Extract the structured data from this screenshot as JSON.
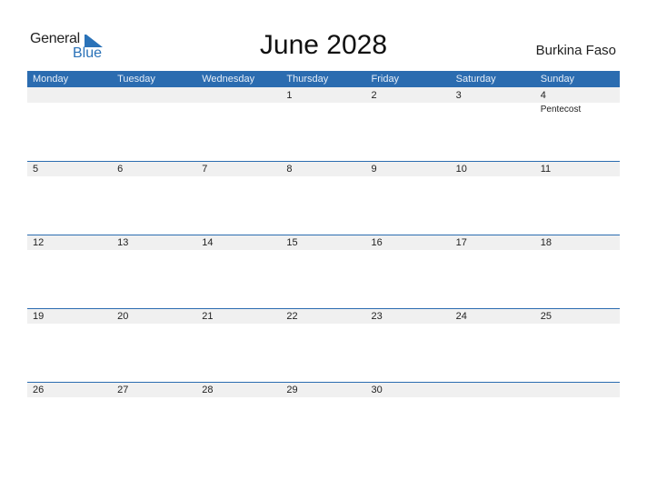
{
  "logo": {
    "general": "General",
    "blue": "Blue"
  },
  "title": "June 2028",
  "country": "Burkina Faso",
  "colors": {
    "accent": "#2b6cb0",
    "band": "#f0f0f0"
  },
  "days": [
    "Monday",
    "Tuesday",
    "Wednesday",
    "Thursday",
    "Friday",
    "Saturday",
    "Sunday"
  ],
  "weeks": [
    [
      {
        "d": ""
      },
      {
        "d": ""
      },
      {
        "d": ""
      },
      {
        "d": "1"
      },
      {
        "d": "2"
      },
      {
        "d": "3"
      },
      {
        "d": "4",
        "event": "Pentecost"
      }
    ],
    [
      {
        "d": "5"
      },
      {
        "d": "6"
      },
      {
        "d": "7"
      },
      {
        "d": "8"
      },
      {
        "d": "9"
      },
      {
        "d": "10"
      },
      {
        "d": "11"
      }
    ],
    [
      {
        "d": "12"
      },
      {
        "d": "13"
      },
      {
        "d": "14"
      },
      {
        "d": "15"
      },
      {
        "d": "16"
      },
      {
        "d": "17"
      },
      {
        "d": "18"
      }
    ],
    [
      {
        "d": "19"
      },
      {
        "d": "20"
      },
      {
        "d": "21"
      },
      {
        "d": "22"
      },
      {
        "d": "23"
      },
      {
        "d": "24"
      },
      {
        "d": "25"
      }
    ],
    [
      {
        "d": "26"
      },
      {
        "d": "27"
      },
      {
        "d": "28"
      },
      {
        "d": "29"
      },
      {
        "d": "30"
      },
      {
        "d": ""
      },
      {
        "d": ""
      }
    ]
  ]
}
